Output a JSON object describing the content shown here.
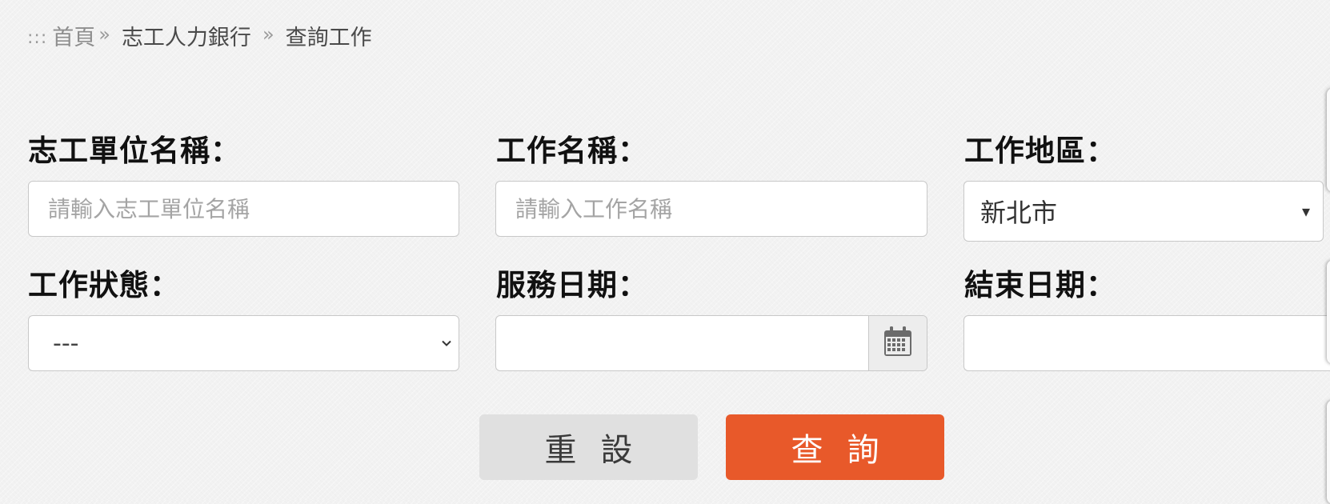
{
  "breadcrumb": {
    "dots": ":::",
    "home": "首頁",
    "sep1": "»",
    "item1": "志工人力銀行",
    "sep2": "»",
    "item2": "查詢工作"
  },
  "form": {
    "unit_name": {
      "label": "志工單位名稱：",
      "placeholder": "請輸入志工單位名稱",
      "value": ""
    },
    "job_name": {
      "label": "工作名稱：",
      "placeholder": "請輸入工作名稱",
      "value": ""
    },
    "job_area": {
      "label": "工作地區：",
      "value": "新北市"
    },
    "job_status": {
      "label": "工作狀態：",
      "value": "---"
    },
    "service_date": {
      "label": "服務日期：",
      "value": ""
    },
    "end_date": {
      "label": "結束日期：",
      "value": ""
    }
  },
  "buttons": {
    "reset": "重設",
    "search": "查詢"
  },
  "icons": {
    "calendar": "calendar-icon",
    "area_arrow": "caret-down-icon",
    "status_arrow": "chevron-down-icon"
  },
  "colors": {
    "search_button": "#e8592a",
    "reset_button": "#e0e0e0",
    "background": "#f2f2f2"
  }
}
